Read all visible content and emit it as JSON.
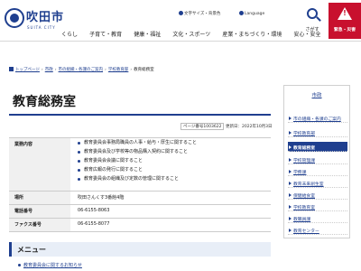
{
  "header": {
    "logo_name": "吹田市",
    "logo_sub": "SUITA CITY",
    "text_size_label": "文字サイズ・背景色",
    "language_label": "Language",
    "nav": [
      "くらし",
      "子育て・教育",
      "健康・福祉",
      "文化・スポーツ",
      "産業・まちづくり・環境",
      "安心・安全",
      "市政"
    ],
    "search_label": "さがす",
    "emergency_label": "緊急・災害"
  },
  "breadcrumb": {
    "items": [
      "トップページ",
      "市政",
      "市の組織・各課のご案内",
      "学校教育部"
    ],
    "current": "教育総務室"
  },
  "page": {
    "title": "教育総務室",
    "page_id": "ページ番号1003622",
    "updated": "更新日：2022年10月3日"
  },
  "info": {
    "duties_label": "業務内容",
    "duties": [
      "教育委員会事務局職員の人事・給与・厚生に関すること",
      "教育委員会及び学校等の物品購入契約に関すること",
      "教育委員会会議に関すること",
      "教育広報の発行に関すること",
      "教育委員会の組織及び定数の管理に関すること"
    ],
    "place_label": "場所",
    "place_value": "吹田さんくす3番館4階",
    "tel_label": "電話番号",
    "tel_value": "06-6155-8063",
    "fax_label": "ファクス番号",
    "fax_value": "06-6155-8077"
  },
  "menu": {
    "heading": "メニュー",
    "link": "教育委員会に関するお知らせ"
  },
  "sidebar": {
    "title": "市政",
    "items": [
      "市の組織・各課のご案内",
      "学校教育部",
      "教育総務室",
      "学校管理課",
      "学務課",
      "教育未来創生室",
      "保健給食室",
      "学校教育室",
      "教職員課",
      "教育センター"
    ]
  },
  "colors": {
    "brand": "#1f3f8f",
    "emergency": "#c8102e",
    "menu_bg": "#e8eef7"
  }
}
